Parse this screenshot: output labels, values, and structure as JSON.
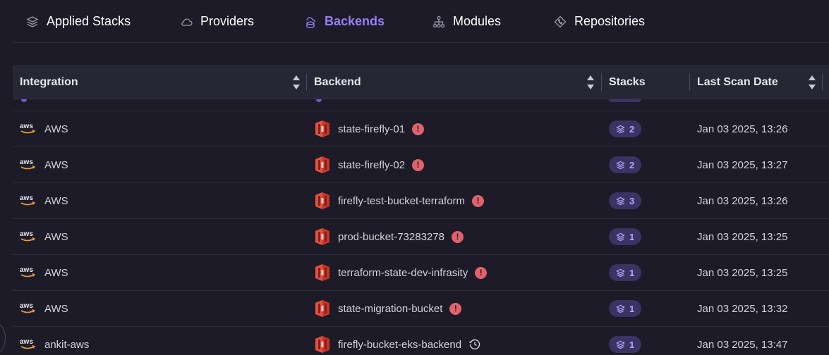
{
  "tabs": [
    {
      "label": "Applied Stacks",
      "icon": "stack-layers-icon"
    },
    {
      "label": "Providers",
      "icon": "cloud-icon"
    },
    {
      "label": "Backends",
      "icon": "database-cloud-icon",
      "active": true
    },
    {
      "label": "Modules",
      "icon": "module-tree-icon"
    },
    {
      "label": "Repositories",
      "icon": "git-repo-icon"
    }
  ],
  "table": {
    "columns": {
      "integration": "Integration",
      "backend": "Backend",
      "stacks": "Stacks",
      "last_scan": "Last Scan Date"
    },
    "rows": [
      {
        "integration": "AWS",
        "backend": "state-firefly-01",
        "status": "alert",
        "stacks": "2",
        "date": "Jan 03 2025, 13:26"
      },
      {
        "integration": "AWS",
        "backend": "state-firefly-02",
        "status": "alert",
        "stacks": "2",
        "date": "Jan 03 2025, 13:27"
      },
      {
        "integration": "AWS",
        "backend": "firefly-test-bucket-terraform",
        "status": "alert",
        "stacks": "3",
        "date": "Jan 03 2025, 13:26"
      },
      {
        "integration": "AWS",
        "backend": "prod-bucket-73283278",
        "status": "alert",
        "stacks": "1",
        "date": "Jan 03 2025, 13:25"
      },
      {
        "integration": "AWS",
        "backend": "terraform-state-dev-infrasity",
        "status": "alert",
        "stacks": "1",
        "date": "Jan 03 2025, 13:25"
      },
      {
        "integration": "AWS",
        "backend": "state-migration-bucket",
        "status": "alert",
        "stacks": "1",
        "date": "Jan 03 2025, 13:32"
      },
      {
        "integration": "ankit-aws",
        "backend": "firefly-bucket-eks-backend",
        "status": "pending",
        "stacks": "1",
        "date": "Jan 03 2025, 13:47"
      }
    ]
  },
  "colors": {
    "background": "#1c1b27",
    "header_bg": "#262635",
    "accent": "#9b7cf6",
    "alert": "#e0636b",
    "badge_bg": "#3a3363",
    "badge_text": "#b9a8ff"
  }
}
